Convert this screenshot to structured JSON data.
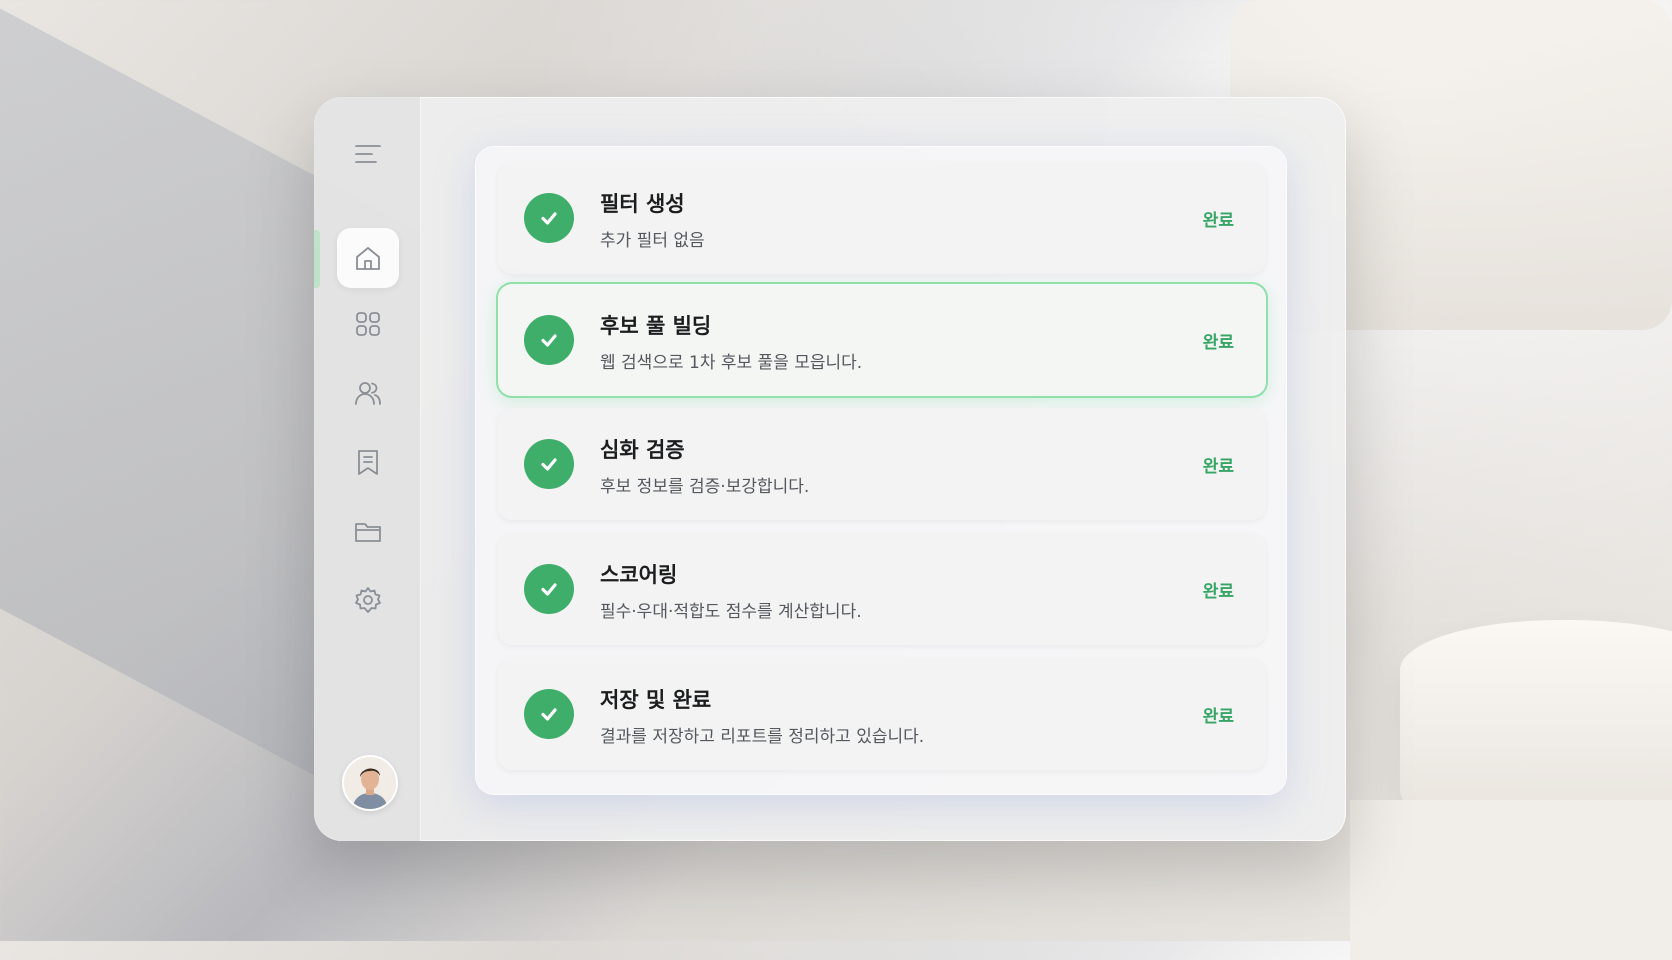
{
  "sidebar": {
    "icons": [
      "menu-icon",
      "home-icon",
      "grid-icon",
      "users-icon",
      "bookmark-icon",
      "folder-icon",
      "gear-icon"
    ],
    "active": "home"
  },
  "steps": [
    {
      "title": "필터 생성",
      "desc": "추가 필터 없음",
      "status": "완료"
    },
    {
      "title": "후보 풀 빌딩",
      "desc": "웹 검색으로 1차 후보 풀을 모읍니다.",
      "status": "완료"
    },
    {
      "title": "심화 검증",
      "desc": "후보 정보를 검증·보강합니다.",
      "status": "완료"
    },
    {
      "title": "스코어링",
      "desc": "필수·우대·적합도 점수를 계산합니다.",
      "status": "완료"
    },
    {
      "title": "저장 및 완료",
      "desc": "결과를 저장하고 리포트를 정리하고 있습니다.",
      "status": "완료"
    }
  ],
  "colors": {
    "accent": "#3fae6b",
    "status": "#37a565",
    "highlight_border": "#8fe0ab"
  }
}
